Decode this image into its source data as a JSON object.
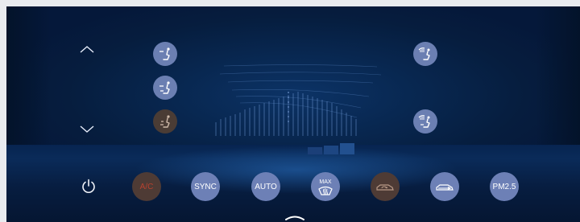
{
  "colors": {
    "background": "#082750",
    "button_active": "#6d80b6",
    "button_inactive": "#4e3b35",
    "ac_label_off": "#b7412f",
    "icon_white": "#ffffff"
  },
  "vent_modes": {
    "driver": [
      {
        "icon": "seat-face-vent-icon",
        "active": true
      },
      {
        "icon": "seat-face-feet-vent-icon",
        "active": true
      },
      {
        "icon": "seat-feet-vent-icon",
        "active": false
      }
    ],
    "passenger": [
      {
        "icon": "seat-windshield-vent-icon",
        "active": true
      },
      {
        "icon": "seat-windshield-feet-vent-icon",
        "active": true
      }
    ]
  },
  "controls": {
    "power": {
      "icon": "power-icon"
    },
    "ac": {
      "label": "A/C",
      "active": false
    },
    "sync": {
      "label": "SYNC",
      "active": true
    },
    "auto": {
      "label": "AUTO",
      "active": true
    },
    "max_defrost": {
      "label": "MAX",
      "icon": "front-defrost-icon",
      "active": true
    },
    "recirculation": {
      "icon": "recirculation-car-icon",
      "active": false
    },
    "fresh_air": {
      "icon": "fresh-air-car-icon",
      "active": true
    },
    "pm25": {
      "label": "PM2.5",
      "active": true
    }
  },
  "nav": {
    "up": {
      "icon": "chevron-up-icon"
    },
    "down": {
      "icon": "chevron-down-icon"
    },
    "panel_handle": {
      "icon": "chevron-up-handle-icon"
    }
  }
}
